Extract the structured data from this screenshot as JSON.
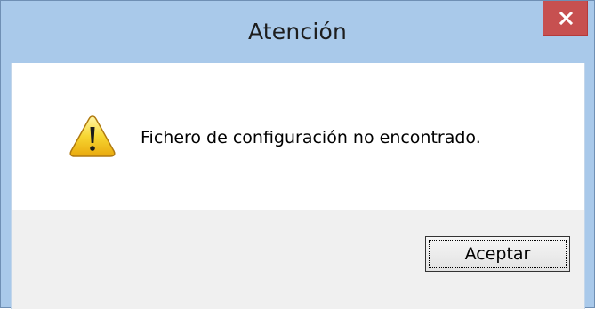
{
  "window": {
    "title": "Atención",
    "close_icon": "close-icon"
  },
  "message": {
    "icon": "warning-icon",
    "text": "Fichero de configuración no encontrado."
  },
  "buttons": {
    "ok_label": "Aceptar"
  },
  "colors": {
    "titlebar": "#a9c9ea",
    "close_button": "#c75050",
    "button_area": "#f0f0f0"
  }
}
